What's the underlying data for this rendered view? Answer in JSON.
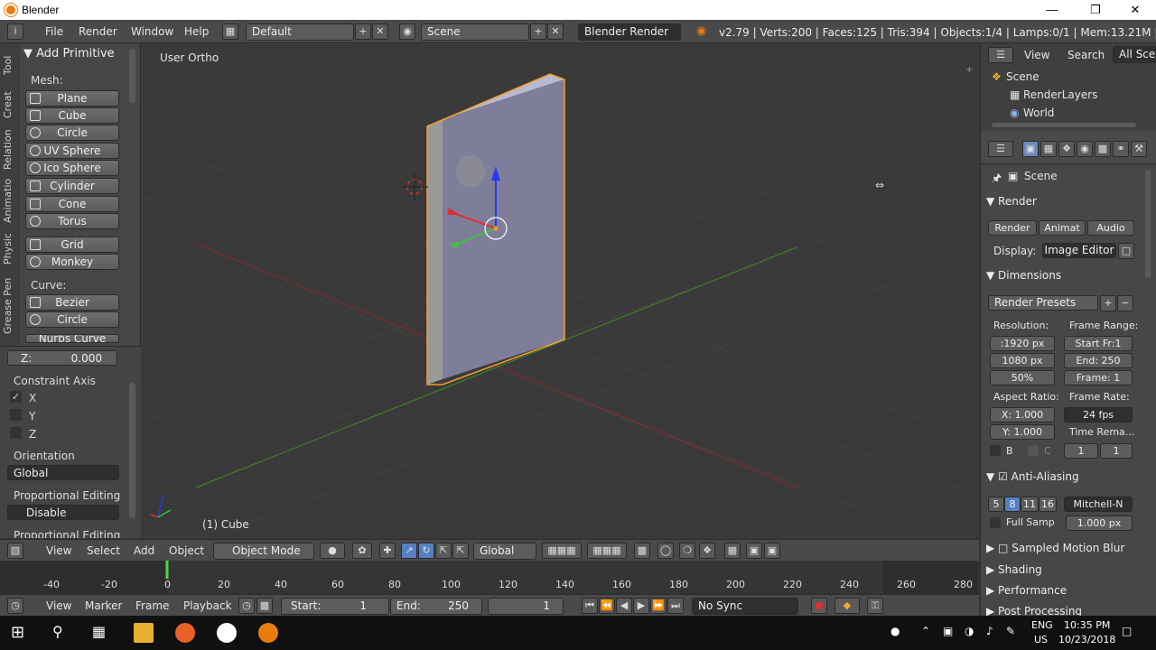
{
  "app": {
    "title": "Blender"
  },
  "topbar": {
    "menus": [
      "File",
      "Render",
      "Window",
      "Help"
    ],
    "layout": "Default",
    "scene": "Scene",
    "engine": "Blender Render",
    "stats": "v2.79 | Verts:200 | Faces:125 | Tris:394 | Objects:1/4 | Lamps:0/1 | Mem:13.21M | Cube"
  },
  "toolshelf": {
    "tabs": [
      "Tool",
      "Creat",
      "Relation",
      "Animatio",
      "Physic",
      "Grease Pen"
    ],
    "panel_title": "Add Primitive",
    "mesh_label": "Mesh:",
    "mesh": [
      "Plane",
      "Cube",
      "Circle",
      "UV Sphere",
      "Ico Sphere",
      "Cylinder",
      "Cone",
      "Torus",
      "Grid",
      "Monkey"
    ],
    "curve_label": "Curve:",
    "curve": [
      "Bezier",
      "Circle",
      "Nurbs Curve"
    ]
  },
  "operator": {
    "z_label": "Z:",
    "z_value": "0.000",
    "constraint_label": "Constraint Axis",
    "axes": [
      "X",
      "Y",
      "Z"
    ],
    "orientation_label": "Orientation",
    "orientation": "Global",
    "prop_label": "Proportional Editing",
    "prop_value": "Disable",
    "prop_label2": "Proportional Editing"
  },
  "viewport": {
    "view_name": "User Ortho",
    "object_name": "(1) Cube"
  },
  "vpheader": {
    "menus": [
      "View",
      "Select",
      "Add",
      "Object"
    ],
    "mode": "Object Mode",
    "orientation": "Global"
  },
  "timeline": {
    "ticks": [
      "-40",
      "-20",
      "0",
      "20",
      "40",
      "60",
      "80",
      "100",
      "120",
      "140",
      "160",
      "180",
      "200",
      "220",
      "240",
      "260",
      "280"
    ],
    "menus": [
      "View",
      "Marker",
      "Frame",
      "Playback"
    ],
    "start_label": "Start:",
    "start": "1",
    "end_label": "End:",
    "end": "250",
    "current": "1",
    "sync": "No Sync"
  },
  "outliner": {
    "menus": [
      "View",
      "Search"
    ],
    "filter": "All Scenes",
    "items": [
      "Scene",
      "RenderLayers",
      "World"
    ]
  },
  "props": {
    "context": "Scene",
    "render_title": "Render",
    "render_btn": "Render",
    "anim_btn": "Animat",
    "audio_btn": "Audio",
    "display_label": "Display:",
    "display": "Image Editor",
    "dimensions": "Dimensions",
    "presets": "Render Presets",
    "resolution": "Resolution:",
    "frame_range": "Frame Range:",
    "res_x": ":1920 px",
    "res_y": "1080 px",
    "res_pct": "50%",
    "start_fr": "Start Fr:1",
    "end": "End: 250",
    "frame": "Frame: 1",
    "aspect": "Aspect Ratio:",
    "frame_rate": "Frame Rate:",
    "asp_x": "X: 1.000",
    "asp_y": "Y: 1.000",
    "fps": "24 fps",
    "time_remap": "Time Rema...",
    "b": "B",
    "c": "C",
    "remap1": "1",
    "remap2": "1",
    "aa": "Anti-Aliasing",
    "aa_samples": [
      "5",
      "8",
      "11",
      "16"
    ],
    "filter": "Mitchell-N",
    "full_samp": "Full Samp",
    "px": "1.000 px",
    "smb": "Sampled Motion Blur",
    "shading": "Shading",
    "performance": "Performance",
    "post": "Post Processing"
  },
  "taskbar": {
    "lang1": "ENG",
    "lang2": "US",
    "time": "10:35 PM",
    "date": "10/23/2018"
  }
}
